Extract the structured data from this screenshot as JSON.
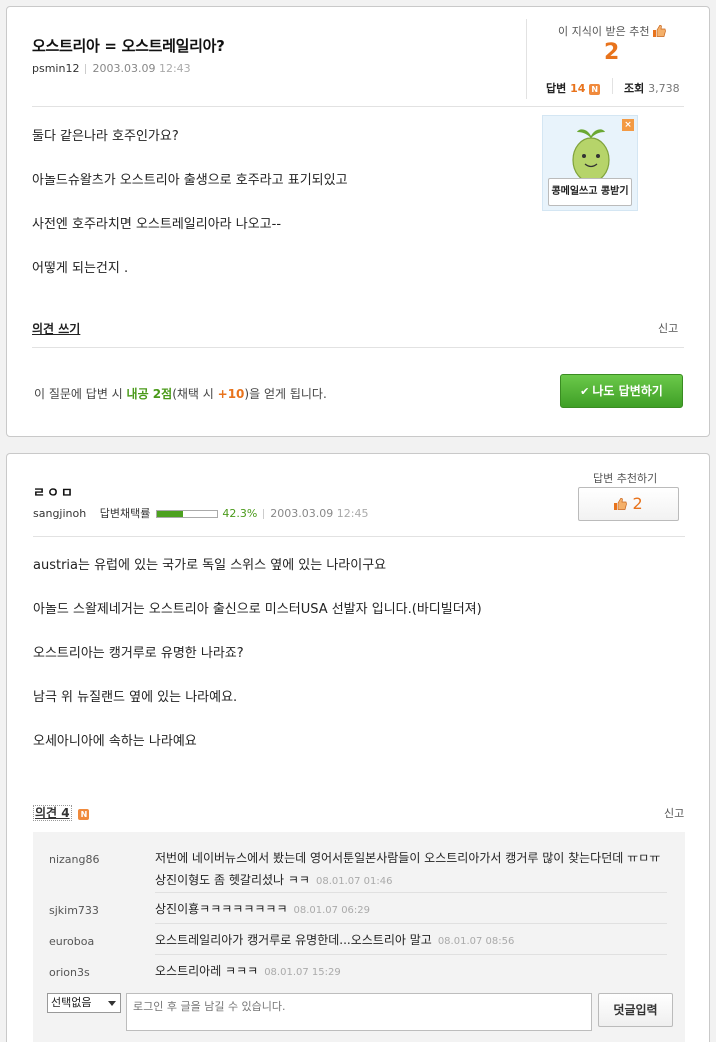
{
  "question": {
    "title": "오스트리아 = 오스트레일리아?",
    "author": "psmin12",
    "date": "2003.03.09",
    "time": "12:43",
    "recommend_label": "이 지식이 받은 추천",
    "recommend_count": "2",
    "answers_label": "답변",
    "answers_count": "14",
    "new_badge": "N",
    "views_label": "조회",
    "views_count": "3,738",
    "body": [
      "둘다 같은나라 호주인가요?",
      "아놀드슈왈츠가 오스트리아 출생으로 호주라고 표기되있고",
      "사전엔 호주라치면 오스트레일리아라 나오고--",
      "어떻게 되는건지 ."
    ],
    "ad": {
      "label": "콩메일쓰고 콩받기",
      "close": "×"
    },
    "opinion_link": "의견 쓰기",
    "report": "신고",
    "bonus": {
      "prefix": "이 질문에 답변 시 ",
      "points": "내공 2점",
      "mid": "(채택 시 ",
      "extra": "+10",
      "suffix": ")을 얻게 됩니다."
    },
    "answer_button": "나도 답변하기"
  },
  "answer": {
    "title": "ㄹㅇㅁ",
    "author": "sangjinoh",
    "adopt_label": "답변채택률",
    "adopt_rate": "42.3%",
    "adopt_fraction": 0.423,
    "date": "2003.03.09",
    "time": "12:45",
    "recommend_label": "답변 추천하기",
    "recommend_count": "2",
    "body": [
      "austria는 유럽에 있는 국가로 독일 스위스 옆에 있는 나라이구요",
      "아놀드 스왈제네거는 오스트리아 출신으로 미스터USA 선발자 입니다.(바디빌더져)",
      "오스트리아는 캥거루로 유명한 나라죠?",
      "남극 위 뉴질랜드 옆에 있는 나라예요.",
      "오세아니아에 속하는 나라예요"
    ],
    "opinion_link": "의견 4",
    "new_badge": "N",
    "report": "신고",
    "comments": [
      {
        "user": "nizang86",
        "text": "저번에 네이버뉴스에서 봤는데 영어서툰일본사람들이 오스트리아가서 캥거루 많이 찾는다던데 ㅠㅁㅠ 상진이형도 좀 헷갈리셨나 ㅋㅋ",
        "date": "08.01.07 01:46"
      },
      {
        "user": "sjkim733",
        "text": "상진이횽ㅋㅋㅋㅋㅋㅋㅋㅋ",
        "date": "08.01.07 06:29"
      },
      {
        "user": "euroboa",
        "text": "오스트레일리아가 캥거루로 유명한데...오스트리아 말고",
        "date": "08.01.07 08:56"
      },
      {
        "user": "orion3s",
        "text": "오스트리아레 ㅋㅋㅋ",
        "date": "08.01.07 15:29"
      }
    ],
    "select_value": "선택없음",
    "comment_placeholder": "로그인 후 글을 남길 수 있습니다.",
    "comment_submit": "덧글입력"
  },
  "colors": {
    "accent_orange": "#e8731c",
    "accent_green": "#4a9a1a",
    "button_green": "#3f9f26"
  }
}
